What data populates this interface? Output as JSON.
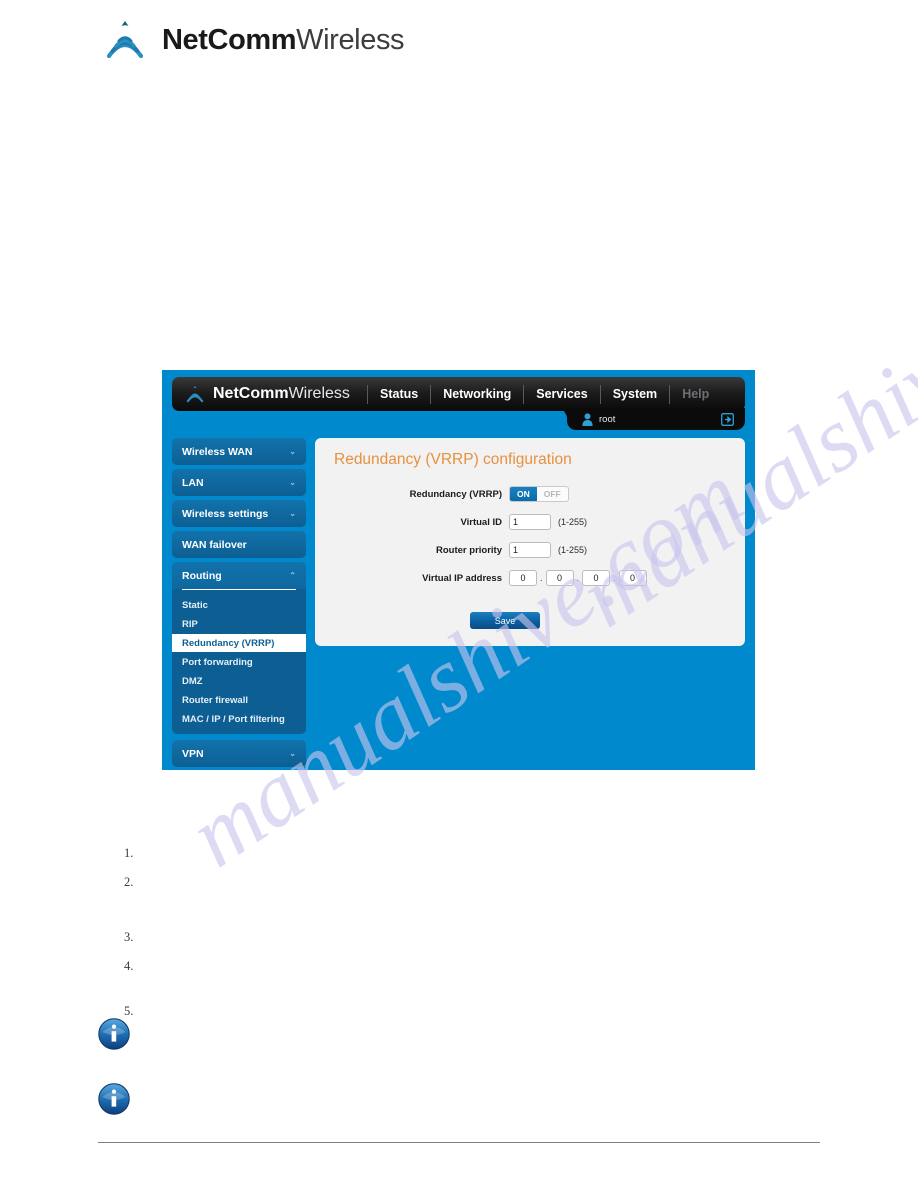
{
  "page": {
    "watermark": "manualshive.com"
  },
  "brand": {
    "bold": "NetComm",
    "light": "Wireless",
    "logo_icon": "netcomm-wave-logo-icon"
  },
  "router_ui": {
    "brand": {
      "bold": "NetComm",
      "light": "Wireless",
      "logo_icon": "netcomm-wave-logo-icon"
    },
    "nav": [
      {
        "label": "Status",
        "dim": false
      },
      {
        "label": "Networking",
        "dim": false
      },
      {
        "label": "Services",
        "dim": false
      },
      {
        "label": "System",
        "dim": false
      },
      {
        "label": "Help",
        "dim": true
      }
    ],
    "user": {
      "name": "root",
      "person_icon": "user-person-icon",
      "logout_icon": "logout-arrow-icon"
    },
    "sidebar": [
      {
        "label": "Wireless WAN",
        "chevron": "⌄",
        "expanded": false
      },
      {
        "label": "LAN",
        "chevron": "⌄",
        "expanded": false
      },
      {
        "label": "Wireless settings",
        "chevron": "⌄",
        "expanded": false
      },
      {
        "label": "WAN failover",
        "chevron": "",
        "expanded": false
      },
      {
        "label": "Routing",
        "chevron": "⌃",
        "expanded": true,
        "items": [
          {
            "label": "Static",
            "active": false
          },
          {
            "label": "RIP",
            "active": false
          },
          {
            "label": "Redundancy (VRRP)",
            "active": true
          },
          {
            "label": "Port forwarding",
            "active": false
          },
          {
            "label": "DMZ",
            "active": false
          },
          {
            "label": "Router firewall",
            "active": false
          },
          {
            "label": "MAC / IP / Port filtering",
            "active": false
          }
        ]
      },
      {
        "label": "VPN",
        "chevron": "⌄",
        "expanded": false
      }
    ],
    "card": {
      "title": "Redundancy (VRRP) configuration",
      "fields": {
        "redundancy": {
          "label": "Redundancy (VRRP)",
          "on_label": "ON",
          "off_label": "OFF",
          "value": "ON"
        },
        "virtual_id": {
          "label": "Virtual ID",
          "value": "1",
          "hint": "(1-255)"
        },
        "router_priority": {
          "label": "Router priority",
          "value": "1",
          "hint": "(1-255)"
        },
        "virtual_ip": {
          "label": "Virtual IP address",
          "octets": [
            "0",
            "0",
            "0",
            "0"
          ],
          "separator": "."
        }
      },
      "save_label": "Save"
    }
  },
  "steps": [
    {
      "num": "1.",
      "text": ""
    },
    {
      "num": "2.",
      "text": ""
    },
    {
      "num": "3.",
      "text": ""
    },
    {
      "num": "4.",
      "text": ""
    },
    {
      "num": "5.",
      "text": ""
    }
  ],
  "notes": [
    {
      "icon": "info-icon",
      "text": ""
    },
    {
      "icon": "info-icon",
      "text": ""
    }
  ],
  "colors": {
    "ui_blue": "#0089cc",
    "sidebar_blue": "#0d5f93",
    "card_bg": "#f2f2f2",
    "title_orange": "#e8903e",
    "watermark": "#c9c6ee",
    "link_line": "#1d1d8f"
  }
}
